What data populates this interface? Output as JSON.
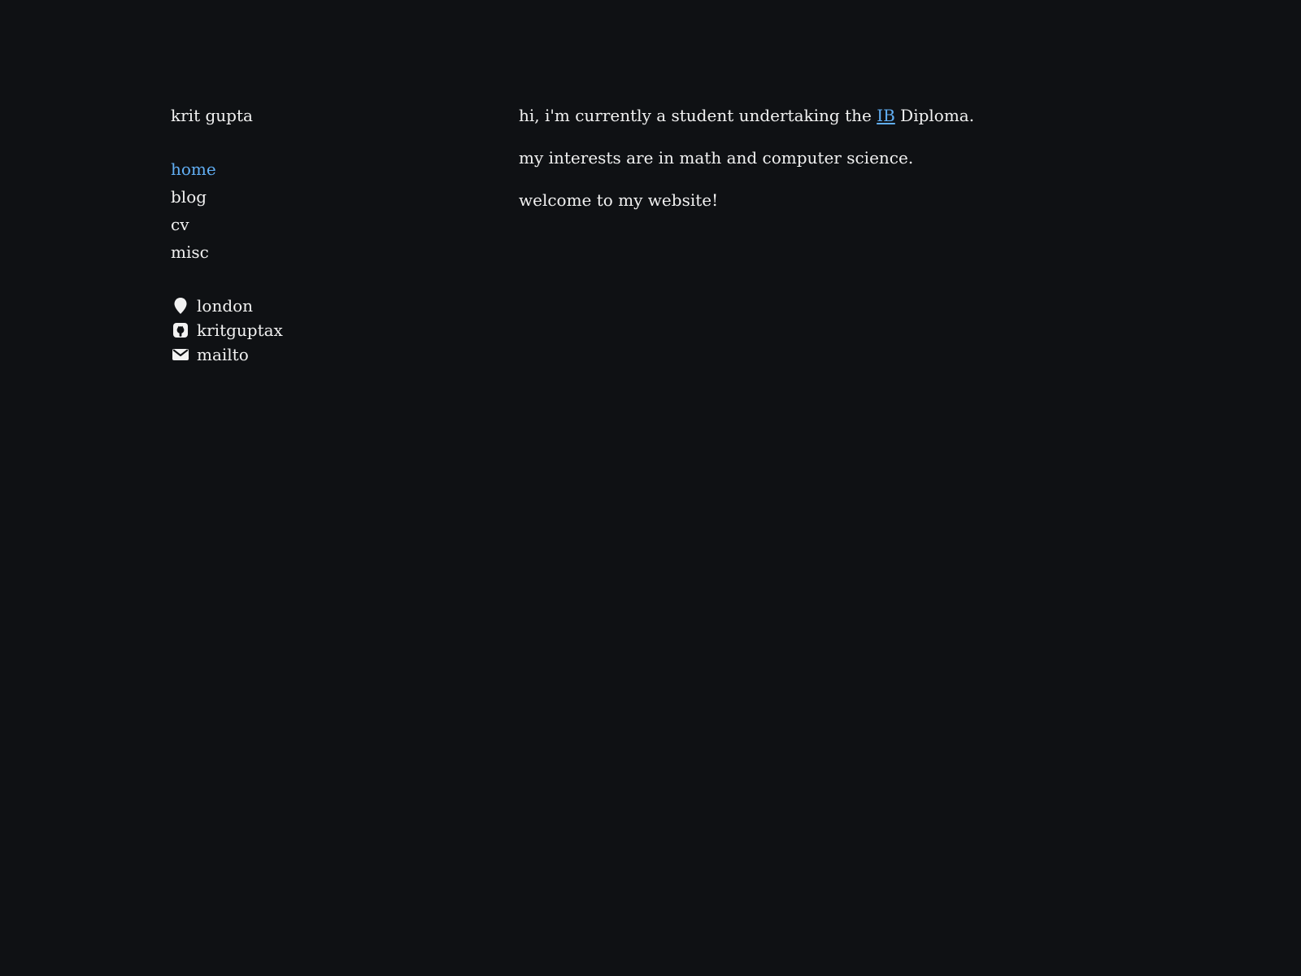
{
  "site": {
    "name": "krit gupta"
  },
  "nav": {
    "items": [
      {
        "label": "home",
        "active": true
      },
      {
        "label": "blog",
        "active": false
      },
      {
        "label": "cv",
        "active": false
      },
      {
        "label": "misc",
        "active": false
      }
    ]
  },
  "contacts": {
    "location": {
      "icon": "map-pin-icon",
      "label": "london"
    },
    "github": {
      "icon": "github-icon",
      "label": "kritguptax"
    },
    "email": {
      "icon": "envelope-icon",
      "label": "mailto"
    }
  },
  "content": {
    "intro": {
      "before_link": "hi, i'm currently a student undertaking the ",
      "link_text": "IB",
      "after_link": " Diploma."
    },
    "interests": "my interests are in math and computer science.",
    "welcome": "welcome to my website!"
  },
  "colors": {
    "background": "#0f1114",
    "text": "#f2f2f2",
    "accent": "#61aff5"
  }
}
